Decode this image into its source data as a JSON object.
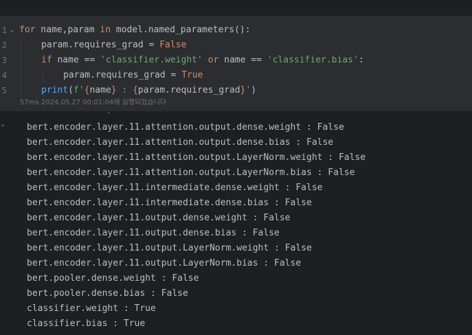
{
  "code_cell": {
    "lines": [
      {
        "number": "1",
        "folded": true,
        "tokens": [
          {
            "t": "for",
            "c": "kw"
          },
          {
            "t": " name,param ",
            "c": "plain"
          },
          {
            "t": "in",
            "c": "kw"
          },
          {
            "t": " model.named_parameters():",
            "c": "plain"
          }
        ]
      },
      {
        "number": "2",
        "indent": 1,
        "tokens": [
          {
            "t": "param.requires_grad = ",
            "c": "plain"
          },
          {
            "t": "False",
            "c": "kw"
          }
        ]
      },
      {
        "number": "3",
        "indent": 1,
        "tokens": [
          {
            "t": "if",
            "c": "kw"
          },
          {
            "t": " name == ",
            "c": "plain"
          },
          {
            "t": "'classifier.weight'",
            "c": "str"
          },
          {
            "t": " ",
            "c": "plain"
          },
          {
            "t": "or",
            "c": "kw"
          },
          {
            "t": " name == ",
            "c": "plain"
          },
          {
            "t": "'classifier.bias'",
            "c": "str"
          },
          {
            "t": ":",
            "c": "plain"
          }
        ]
      },
      {
        "number": "4",
        "indent": 2,
        "tokens": [
          {
            "t": "param.requires_grad = ",
            "c": "plain"
          },
          {
            "t": "True",
            "c": "kw"
          }
        ]
      },
      {
        "number": "5",
        "indent": 1,
        "tokens": [
          {
            "t": "print",
            "c": "fn"
          },
          {
            "t": "(",
            "c": "plain"
          },
          {
            "t": "f'",
            "c": "str"
          },
          {
            "t": "{",
            "c": "kw"
          },
          {
            "t": "name",
            "c": "plain"
          },
          {
            "t": "}",
            "c": "kw"
          },
          {
            "t": " : ",
            "c": "str"
          },
          {
            "t": "{",
            "c": "kw"
          },
          {
            "t": "param.requires_grad",
            "c": "plain"
          },
          {
            "t": "}",
            "c": "kw"
          },
          {
            "t": "'",
            "c": "str"
          },
          {
            "t": ")",
            "c": "plain"
          }
        ]
      }
    ],
    "status": "57ms 2024.05.27 00:01:04에 실행되었습니다"
  },
  "output": {
    "partial_line": "bert.encoder.layer.11.attention.output.dense.weight : False",
    "lines": [
      "bert.encoder.layer.11.attention.output.dense.weight : False",
      "bert.encoder.layer.11.attention.output.dense.bias : False",
      "bert.encoder.layer.11.attention.output.LayerNorm.weight : False",
      "bert.encoder.layer.11.attention.output.LayerNorm.bias : False",
      "bert.encoder.layer.11.intermediate.dense.weight : False",
      "bert.encoder.layer.11.intermediate.dense.bias : False",
      "bert.encoder.layer.11.output.dense.weight : False",
      "bert.encoder.layer.11.output.dense.bias : False",
      "bert.encoder.layer.11.output.LayerNorm.weight : False",
      "bert.encoder.layer.11.output.LayerNorm.bias : False",
      "bert.pooler.dense.weight : False",
      "bert.pooler.dense.bias : False",
      "classifier.weight : True",
      "classifier.bias : True"
    ]
  },
  "icons": {
    "fold": "chevron-down-icon",
    "output_collapse": "chevron-down-icon"
  },
  "colors": {
    "background": "#1e1f22",
    "cell_background": "#2b2d30",
    "keyword": "#cf8e6d",
    "string": "#6aab73",
    "function": "#56a8f5",
    "text": "#bcbec4",
    "line_number": "#6f737a"
  }
}
